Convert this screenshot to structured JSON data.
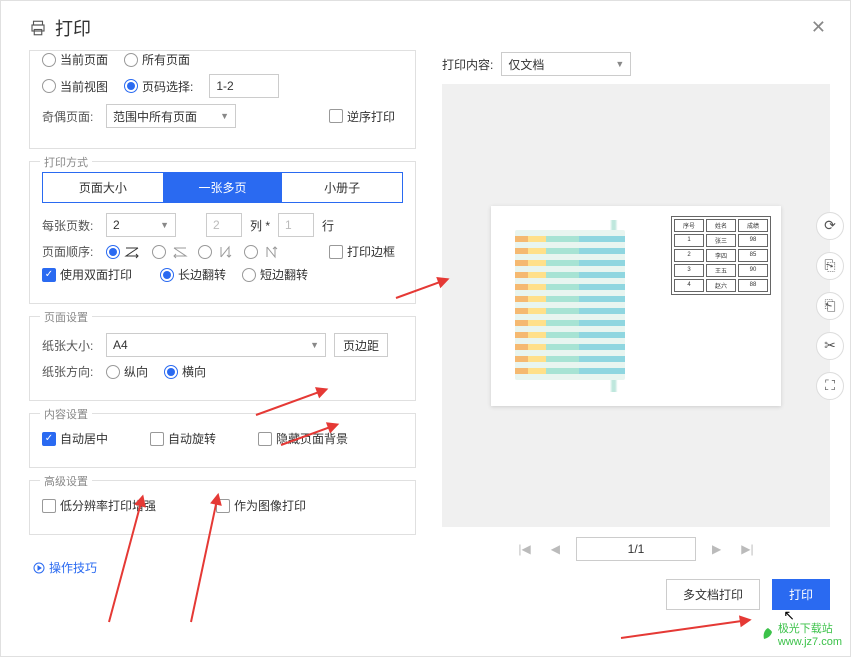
{
  "title": "打印",
  "range": {
    "current_page": "当前页面",
    "all_pages": "所有页面",
    "current_view": "当前视图",
    "page_select": "页码选择:",
    "page_select_value": "1-2",
    "odd_even_label": "奇偶页面:",
    "odd_even_value": "范围中所有页面",
    "reverse_print": "逆序打印"
  },
  "print_method": {
    "title": "打印方式",
    "tabs": [
      "页面大小",
      "一张多页",
      "小册子"
    ],
    "pages_per_sheet_label": "每张页数:",
    "pages_per_sheet_value": "2",
    "cols_value": "2",
    "cols_label": "列 *",
    "rows_value": "1",
    "rows_label": "行",
    "page_order_label": "页面顺序:",
    "print_border": "打印边框",
    "duplex": "使用双面打印",
    "flip_long": "长边翻转",
    "flip_short": "短边翻转"
  },
  "page_setup": {
    "title": "页面设置",
    "size_label": "纸张大小:",
    "size_value": "A4",
    "margins": "页边距",
    "orient_label": "纸张方向:",
    "portrait": "纵向",
    "landscape": "横向"
  },
  "content_setup": {
    "title": "内容设置",
    "auto_center": "自动居中",
    "auto_rotate": "自动旋转",
    "hide_bg": "隐藏页面背景"
  },
  "advanced": {
    "title": "高级设置",
    "lowres": "低分辨率打印增强",
    "as_image": "作为图像打印"
  },
  "tips": "操作技巧",
  "right": {
    "content_label": "打印内容:",
    "content_value": "仅文档",
    "pager": "1/1",
    "multi_doc": "多文档打印",
    "print": "打印"
  },
  "table": {
    "headers": [
      "序号",
      "姓名",
      "成绩"
    ],
    "rows": [
      [
        "1",
        "张三",
        "98"
      ],
      [
        "2",
        "李四",
        "85"
      ],
      [
        "3",
        "王五",
        "90"
      ],
      [
        "4",
        "赵六",
        "88"
      ]
    ]
  },
  "watermark": {
    "site": "极光下载站",
    "url": "www.jz7.com"
  }
}
